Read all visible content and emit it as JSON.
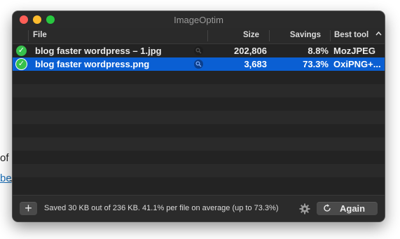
{
  "background": {
    "fragment_text": "of",
    "fragment_link": "be",
    "fragment_period": "."
  },
  "window": {
    "title": "ImageOptim",
    "buttons": {
      "close": "close",
      "minimize": "minimize",
      "zoom": "zoom"
    }
  },
  "table": {
    "headers": {
      "file": "File",
      "size": "Size",
      "savings": "Savings",
      "best_tool": "Best tool"
    },
    "sort_indicator": "^",
    "rows": [
      {
        "file": "blog faster wordpress – 1.jpg",
        "size": "202,806",
        "savings": "8.8%",
        "tool": "MozJPEG",
        "status": "done",
        "selected": false
      },
      {
        "file": "blog faster wordpress.png",
        "size": "3,683",
        "savings": "73.3%",
        "tool": "OxiPNG+...",
        "status": "done",
        "selected": true
      }
    ]
  },
  "footer": {
    "add_label": "+",
    "status": "Saved 30 KB out of 236 KB. 41.1% per file on average (up to 73.3%)",
    "again_label": "Again"
  },
  "colors": {
    "selection": "#0a5fd3",
    "check": "#37c14c",
    "window_bg": "#232323"
  },
  "icons": [
    "checkmark-icon",
    "magnifier-icon",
    "gear-icon",
    "refresh-icon",
    "plus-icon"
  ]
}
